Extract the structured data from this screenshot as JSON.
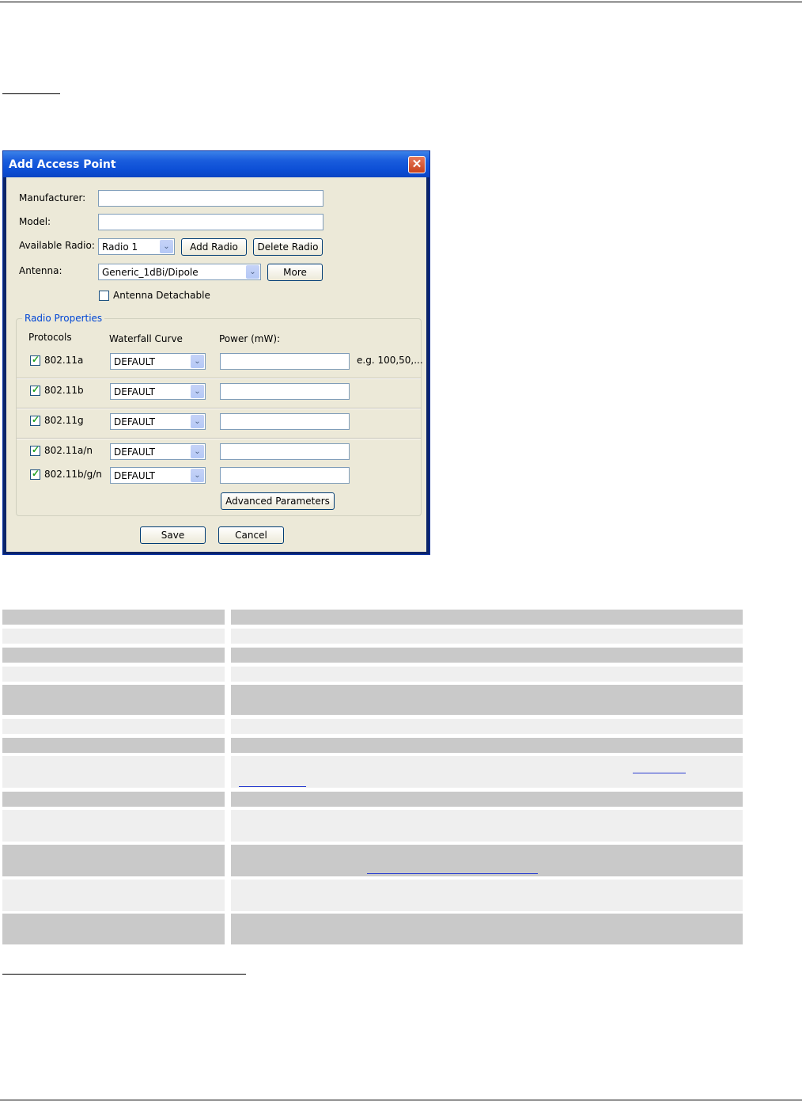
{
  "dialog": {
    "title": "Add Access Point",
    "close_label": "✕",
    "manufacturer_label": "Manufacturer:",
    "manufacturer_value": "",
    "model_label": "Model:",
    "model_value": "",
    "available_radio_label": "Available Radio:",
    "available_radio_value": "Radio 1",
    "add_radio_label": "Add Radio",
    "delete_radio_label": "Delete Radio",
    "antenna_label": "Antenna:",
    "antenna_value": "Generic_1dBi/Dipole",
    "more_label": "More",
    "antenna_detachable_label": "Antenna Detachable",
    "antenna_detachable_checked": false,
    "radio_properties_title": "Radio Properties",
    "col_protocols": "Protocols",
    "col_waterfall": "Waterfall Curve",
    "col_power": "Power (mW):",
    "power_hint": "e.g. 100,50,...",
    "protocols": [
      {
        "name": "802.11a",
        "checked": true,
        "curve": "DEFAULT",
        "power": ""
      },
      {
        "name": "802.11b",
        "checked": true,
        "curve": "DEFAULT",
        "power": ""
      },
      {
        "name": "802.11g",
        "checked": true,
        "curve": "DEFAULT",
        "power": ""
      },
      {
        "name": "802.11a/n",
        "checked": true,
        "curve": "DEFAULT",
        "power": ""
      },
      {
        "name": "802.11b/g/n",
        "checked": true,
        "curve": "DEFAULT",
        "power": ""
      }
    ],
    "advanced_parameters_label": "Advanced Parameters",
    "save_label": "Save",
    "cancel_label": "Cancel"
  },
  "arrow_glyph": "⌄",
  "check_glyph": "✓"
}
